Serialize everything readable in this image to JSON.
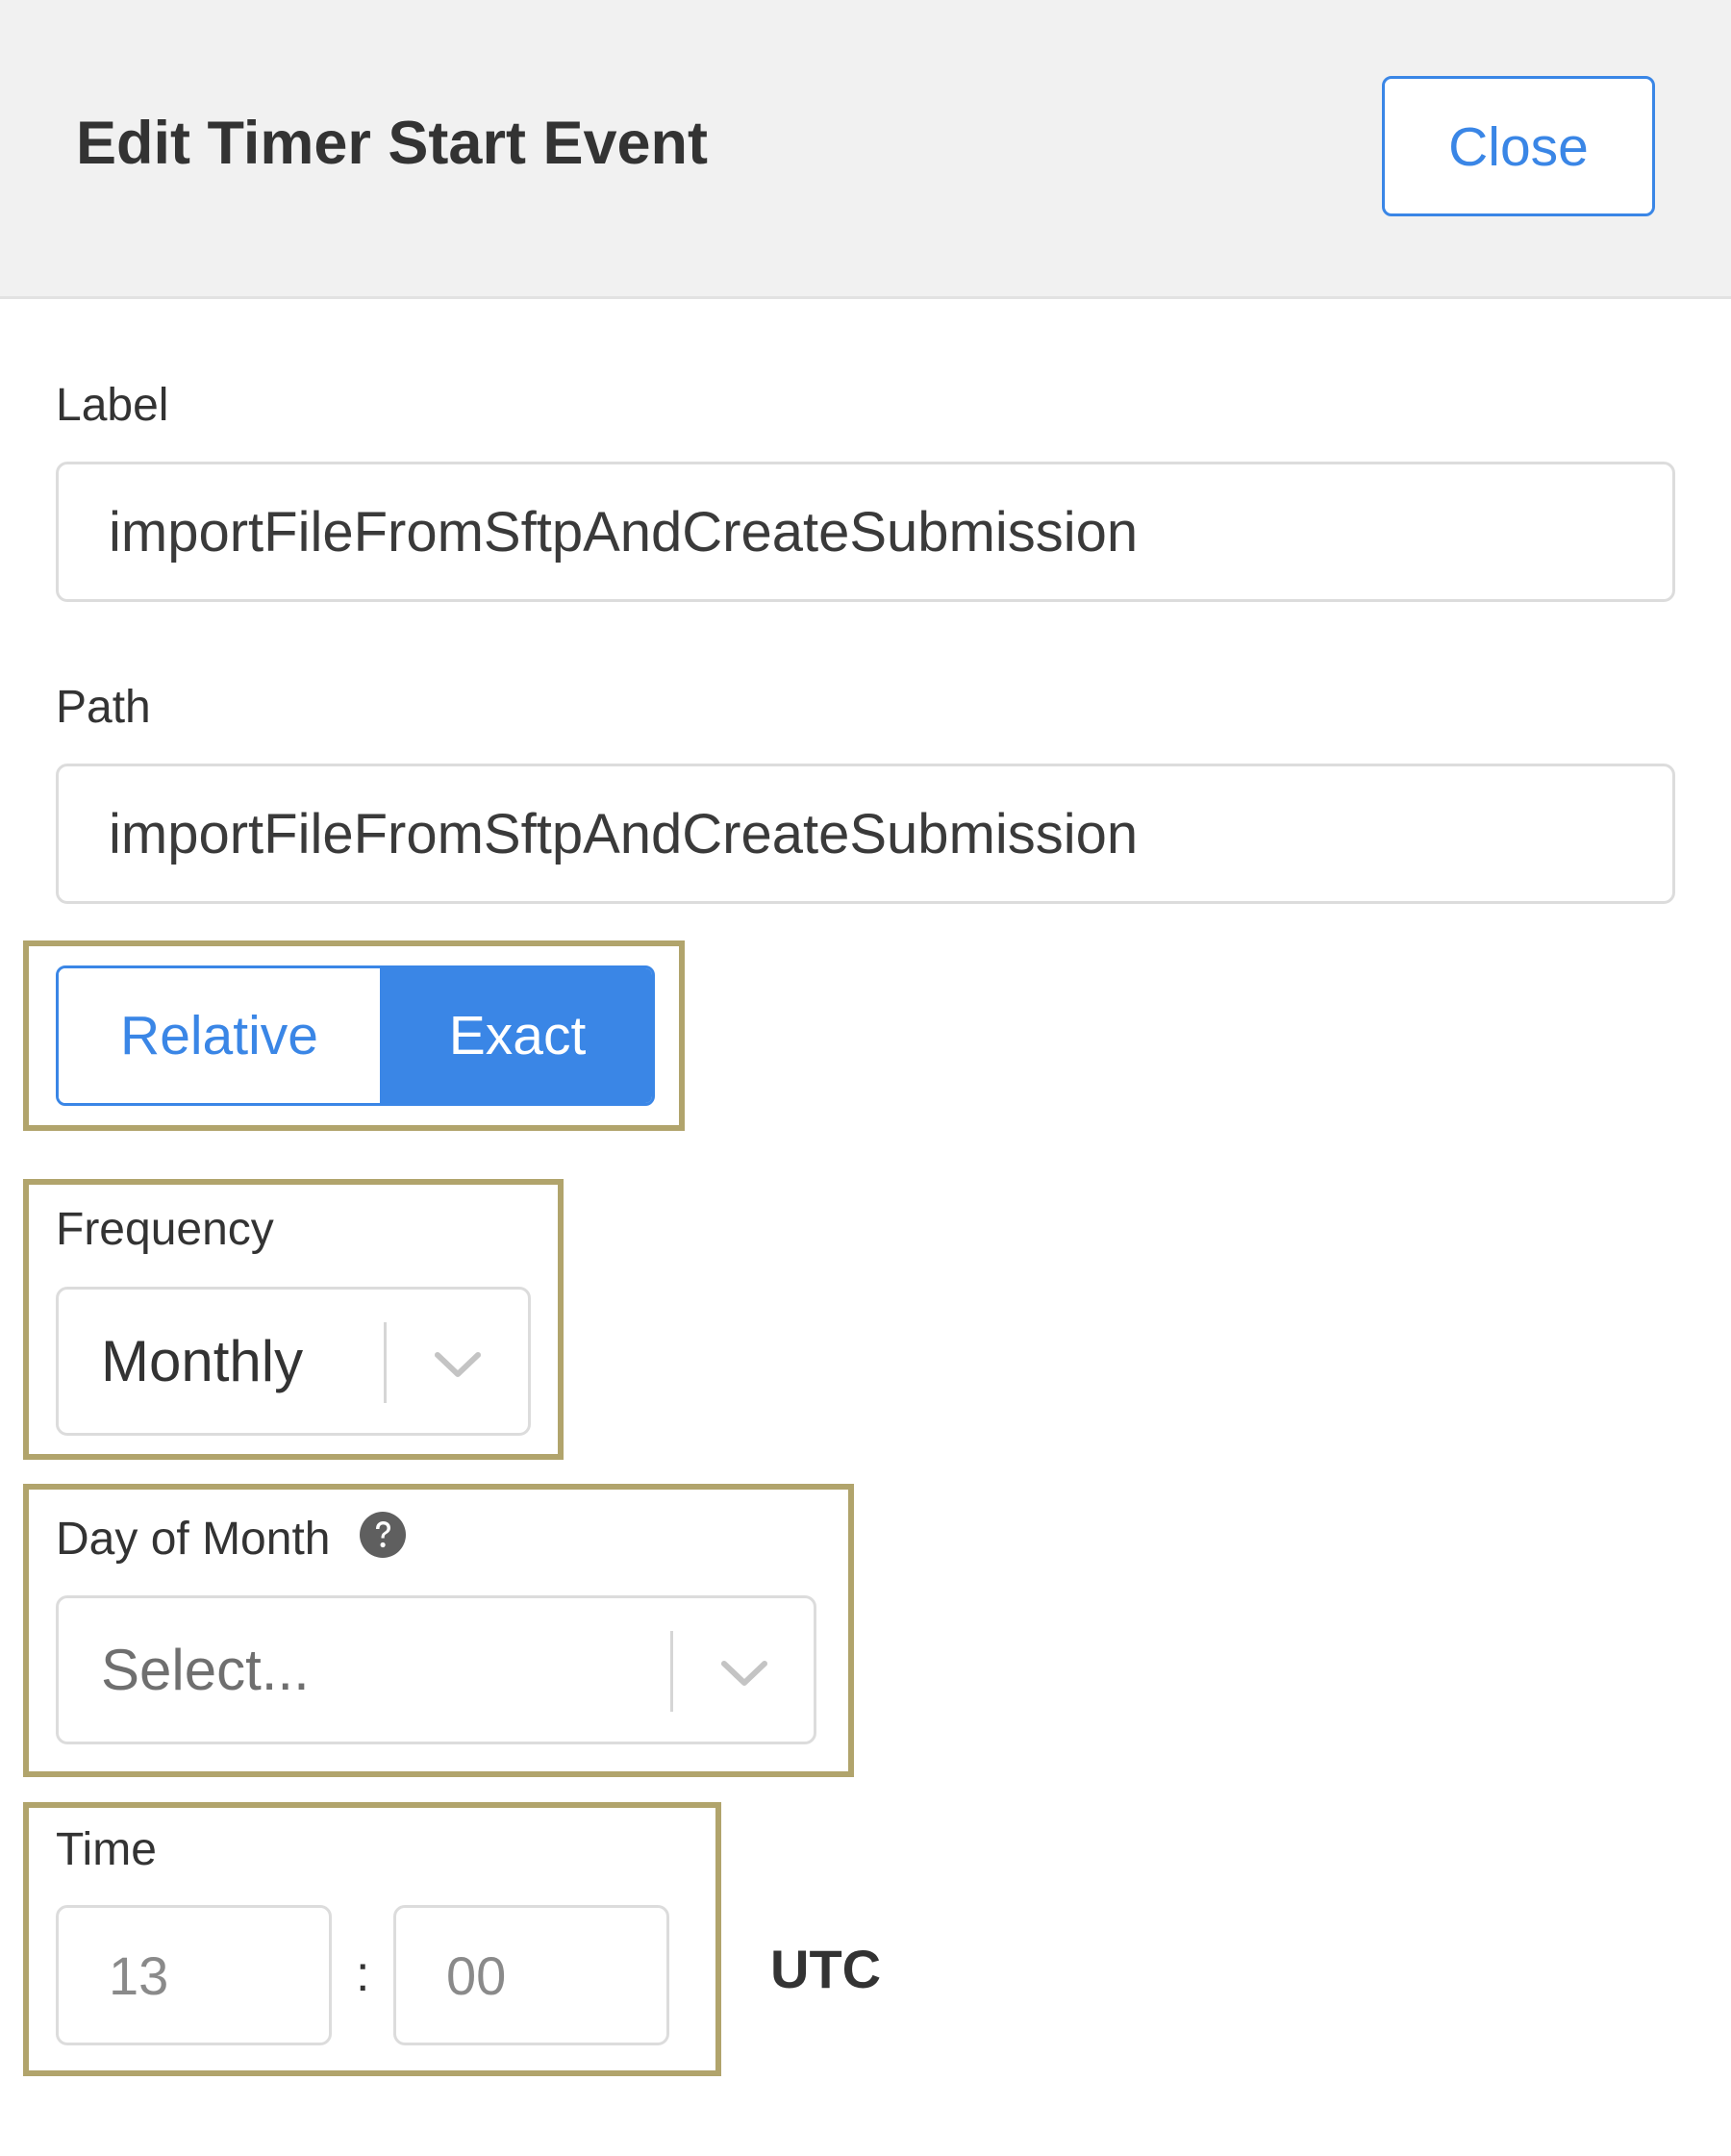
{
  "header": {
    "title": "Edit Timer Start Event",
    "close_label": "Close"
  },
  "form": {
    "label": {
      "caption": "Label",
      "value": "importFileFromSftpAndCreateSubmission"
    },
    "path": {
      "caption": "Path",
      "value": "importFileFromSftpAndCreateSubmission"
    },
    "mode_toggle": {
      "options": [
        "Relative",
        "Exact"
      ],
      "selected": "Exact"
    },
    "frequency": {
      "caption": "Frequency",
      "selected": "Monthly"
    },
    "day_of_month": {
      "caption": "Day of Month",
      "placeholder": "Select..."
    },
    "time": {
      "caption": "Time",
      "hour": "13",
      "minute": "00",
      "separator": ":",
      "timezone": "UTC"
    }
  },
  "colors": {
    "accent": "#3a86e6",
    "highlight_border": "#b1a46c",
    "header_bg": "#f1f1f1"
  },
  "icons": {
    "dropdown": "chevron-down-icon",
    "help": "question-circle-icon"
  }
}
